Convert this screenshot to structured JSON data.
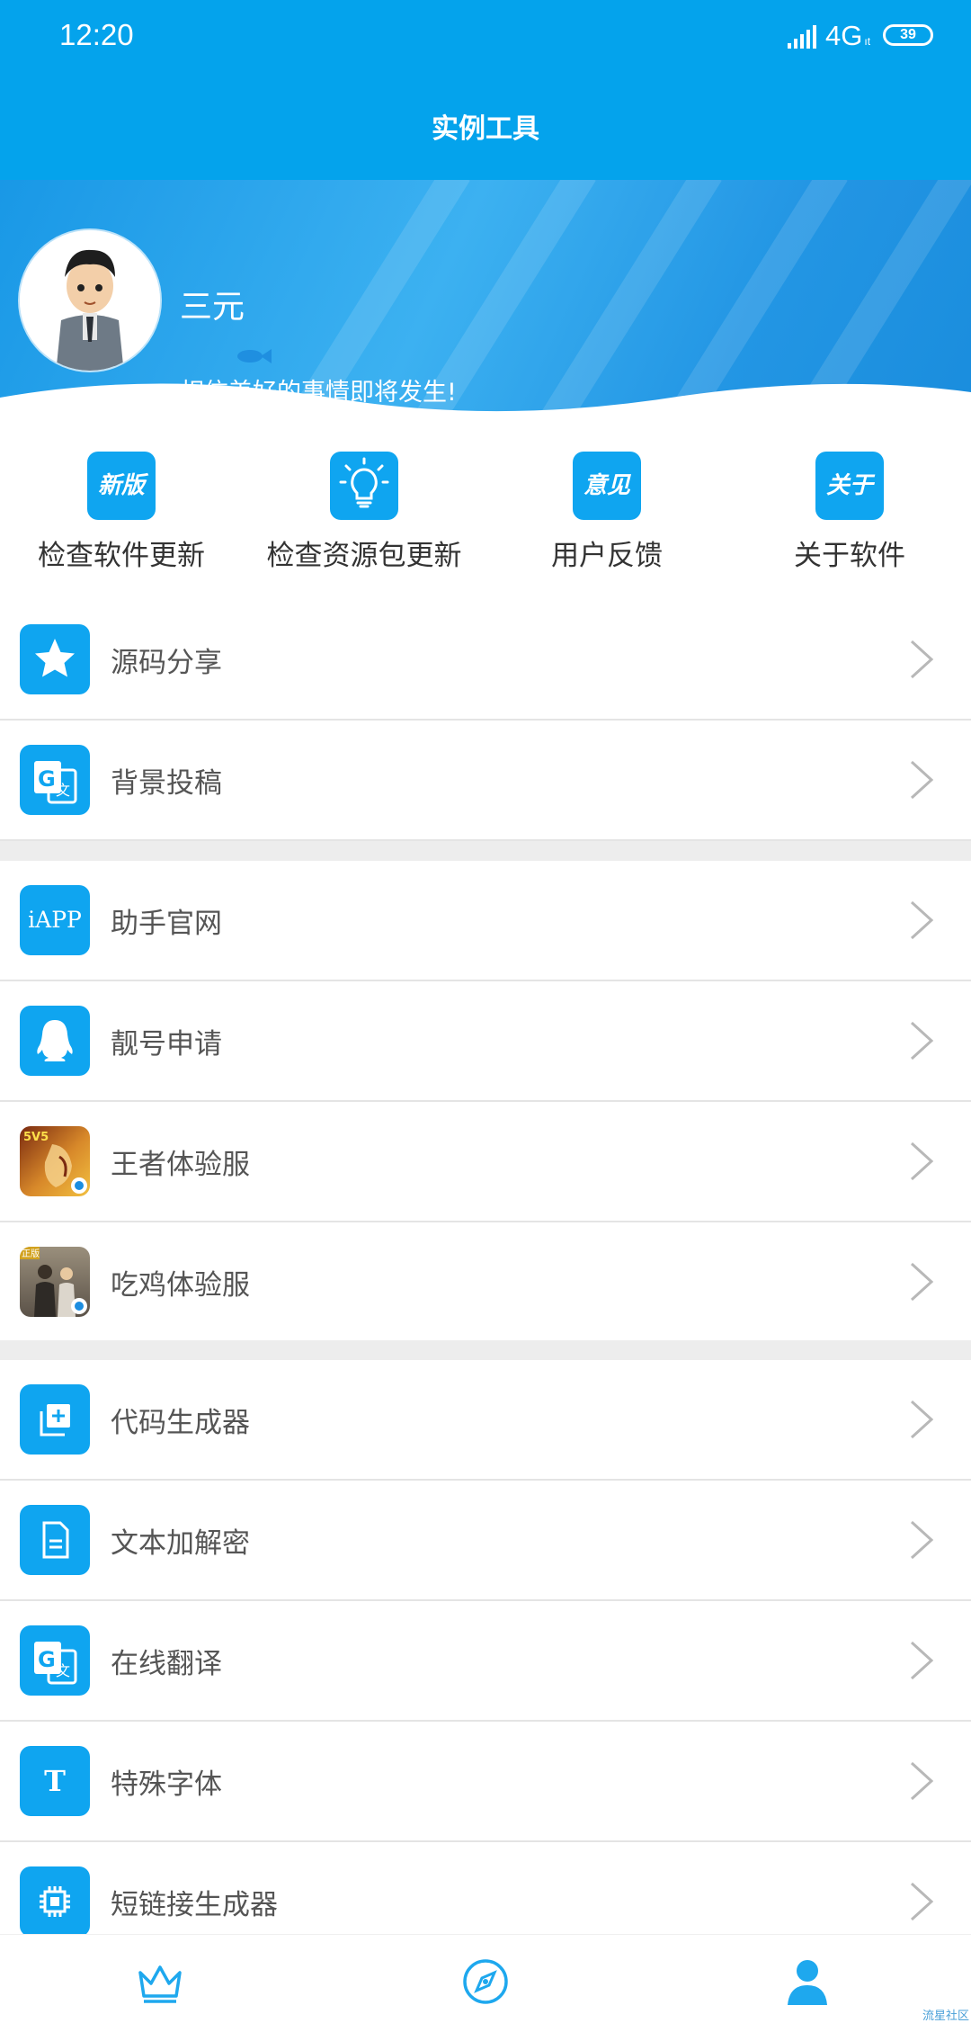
{
  "status_bar": {
    "time": "12:20",
    "network": "4G",
    "network_sub": "ıt",
    "battery": "39"
  },
  "header": {
    "title": "实例工具"
  },
  "profile": {
    "name": "三元",
    "motto": "相信美好的事情即将发生!"
  },
  "quick_actions": [
    {
      "label": "检查软件更新",
      "icon_text": "新版",
      "icon": "new-version-icon"
    },
    {
      "label": "检查资源包更新",
      "icon_text": "",
      "icon": "lightbulb-icon"
    },
    {
      "label": "用户反馈",
      "icon_text": "意见",
      "icon": "feedback-icon"
    },
    {
      "label": "关于软件",
      "icon_text": "关于",
      "icon": "about-icon"
    }
  ],
  "menu": [
    {
      "label": "源码分享",
      "icon": "star-icon"
    },
    {
      "label": "背景投稿",
      "icon": "translate-icon"
    },
    {
      "label": "助手官网",
      "icon": "iapp-icon",
      "icon_text": "iAPP"
    },
    {
      "label": "靓号申请",
      "icon": "qq-icon"
    },
    {
      "label": "王者体验服",
      "icon": "honor-of-kings-icon",
      "badge": "5V5"
    },
    {
      "label": "吃鸡体验服",
      "icon": "pubg-icon",
      "badge": "正版"
    },
    {
      "label": "代码生成器",
      "icon": "add-copy-icon"
    },
    {
      "label": "文本加解密",
      "icon": "document-icon"
    },
    {
      "label": "在线翻译",
      "icon": "translate-icon"
    },
    {
      "label": "特殊字体",
      "icon": "font-icon",
      "icon_text": "T"
    },
    {
      "label": "短链接生成器",
      "icon": "chip-icon"
    }
  ],
  "tabs": [
    {
      "name": "crown-icon"
    },
    {
      "name": "compass-icon"
    },
    {
      "name": "person-icon",
      "active": true
    }
  ],
  "watermark": "流星社区",
  "colors": {
    "primary": "#04a3ec",
    "icon_bg": "#0fa5f0",
    "separator": "#ededed"
  }
}
